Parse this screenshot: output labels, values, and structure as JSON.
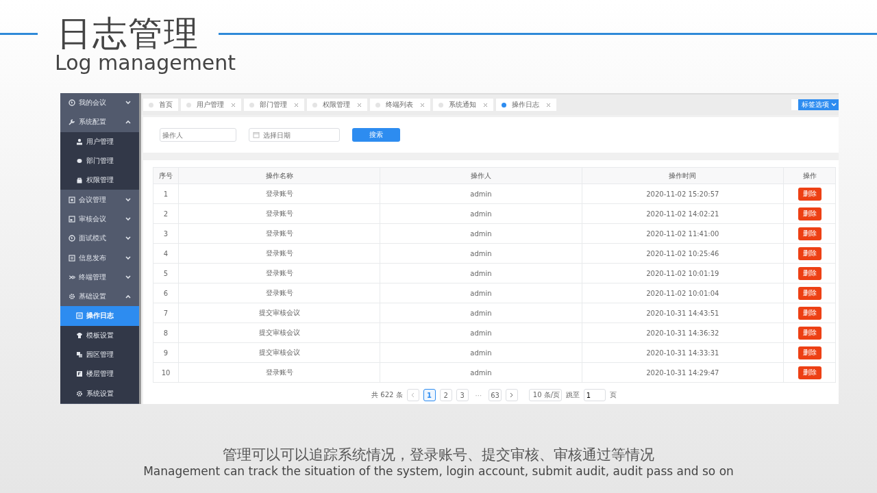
{
  "slide": {
    "title": "日志管理",
    "subtitle": "Log management",
    "caption": "管理可以可以追踪系统情况，登录账号、提交审核、审核通过等情况",
    "caption_en": "Management can track the situation of the system, login account, submit audit, audit pass and so on"
  },
  "sidebar": {
    "items": [
      {
        "label": "我的会议",
        "expanded": false,
        "selected": false
      },
      {
        "label": "系统配置",
        "expanded": true,
        "selected": false,
        "children": [
          {
            "label": "用户管理",
            "selected": false
          },
          {
            "label": "部门管理",
            "selected": false
          },
          {
            "label": "权限管理",
            "selected": false
          }
        ]
      },
      {
        "label": "会议管理",
        "expanded": false,
        "selected": false
      },
      {
        "label": "审核会议",
        "expanded": false,
        "selected": false
      },
      {
        "label": "面试模式",
        "expanded": false,
        "selected": false
      },
      {
        "label": "信息发布",
        "expanded": false,
        "selected": false
      },
      {
        "label": "终端管理",
        "expanded": false,
        "selected": false
      },
      {
        "label": "基础设置",
        "expanded": true,
        "selected": false,
        "children": [
          {
            "label": "操作日志",
            "selected": true
          },
          {
            "label": "模板设置",
            "selected": false
          },
          {
            "label": "园区管理",
            "selected": false
          },
          {
            "label": "楼层管理",
            "selected": false
          },
          {
            "label": "系统设置",
            "selected": false
          }
        ]
      }
    ]
  },
  "tabs": [
    {
      "label": "首页",
      "selected": false,
      "closable": false
    },
    {
      "label": "用户管理",
      "selected": false,
      "closable": true
    },
    {
      "label": "部门管理",
      "selected": false,
      "closable": true
    },
    {
      "label": "权限管理",
      "selected": false,
      "closable": true
    },
    {
      "label": "终端列表",
      "selected": false,
      "closable": true
    },
    {
      "label": "系统通知",
      "selected": false,
      "closable": true
    },
    {
      "label": "操作日志",
      "selected": true,
      "closable": true
    }
  ],
  "tab_options": {
    "label": "标签选项"
  },
  "search": {
    "operator_placeholder": "操作人",
    "date_placeholder": "选择日期",
    "button": "搜索"
  },
  "table": {
    "columns": [
      "序号",
      "操作名称",
      "操作人",
      "操作时间",
      "操作"
    ],
    "rows": [
      {
        "index": "1",
        "name": "登录账号",
        "operator": "admin",
        "time": "2020-11-02 15:20:57",
        "action": "删除"
      },
      {
        "index": "2",
        "name": "登录账号",
        "operator": "admin",
        "time": "2020-11-02 14:02:21",
        "action": "删除"
      },
      {
        "index": "3",
        "name": "登录账号",
        "operator": "admin",
        "time": "2020-11-02 11:41:00",
        "action": "删除"
      },
      {
        "index": "4",
        "name": "登录账号",
        "operator": "admin",
        "time": "2020-11-02 10:25:46",
        "action": "删除"
      },
      {
        "index": "5",
        "name": "登录账号",
        "operator": "admin",
        "time": "2020-11-02 10:01:19",
        "action": "删除"
      },
      {
        "index": "6",
        "name": "登录账号",
        "operator": "admin",
        "time": "2020-11-02 10:01:04",
        "action": "删除"
      },
      {
        "index": "7",
        "name": "提交审核会议",
        "operator": "admin",
        "time": "2020-10-31 14:43:51",
        "action": "删除"
      },
      {
        "index": "8",
        "name": "提交审核会议",
        "operator": "admin",
        "time": "2020-10-31 14:36:32",
        "action": "删除"
      },
      {
        "index": "9",
        "name": "提交审核会议",
        "operator": "admin",
        "time": "2020-10-31 14:33:31",
        "action": "删除"
      },
      {
        "index": "10",
        "name": "登录账号",
        "operator": "admin",
        "time": "2020-10-31 14:29:47",
        "action": "删除"
      }
    ]
  },
  "pagination": {
    "total": "共 622 条",
    "pages": [
      {
        "label": "1",
        "kind": "page",
        "selected": true
      },
      {
        "label": "2",
        "kind": "page",
        "selected": false
      },
      {
        "label": "3",
        "kind": "page",
        "selected": false
      },
      {
        "label": "···",
        "kind": "ellipsis"
      },
      {
        "label": "63",
        "kind": "page",
        "selected": false
      }
    ],
    "page_size": "10 条/页",
    "jump_label": "跳至",
    "jump_value": "1",
    "page_unit": "页"
  }
}
